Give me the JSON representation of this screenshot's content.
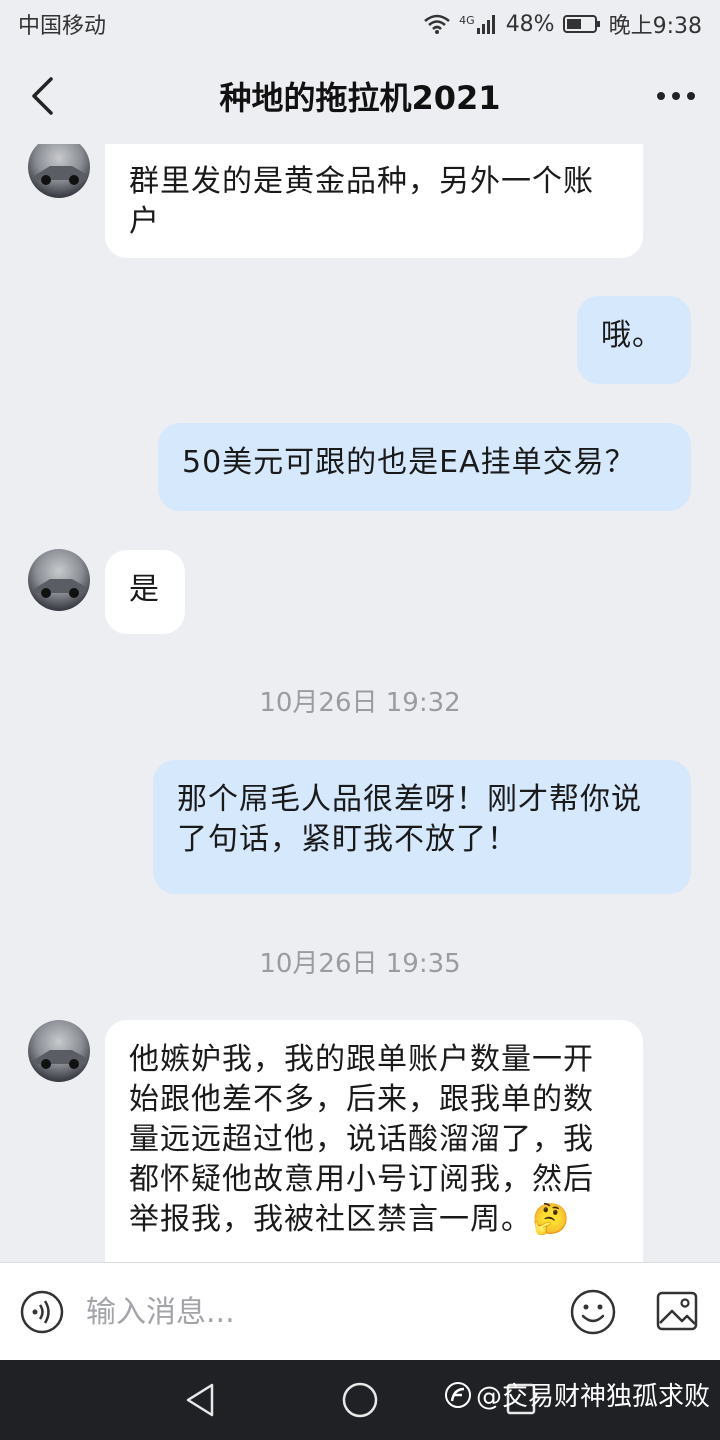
{
  "status_bar": {
    "carrier": "中国移动",
    "network": "4G",
    "battery": "48%",
    "time": "晚上9:38"
  },
  "header": {
    "title": "种地的拖拉机2021"
  },
  "messages": {
    "m1": "群里发的是黄金品种，另外一个账户",
    "m2": "哦。",
    "m3": "50美元可跟的也是EA挂单交易？",
    "m4": "是",
    "t1": "10月26日 19:32",
    "m5": "那个屌毛人品很差呀！刚才帮你说了句话，紧盯我不放了！",
    "t2": "10月26日 19:35",
    "m6": "他嫉妒我，我的跟单账户数量一开始跟他差不多，后来，跟我单的数量远远超过他，说话酸溜溜了，我都怀疑他故意用小号订阅我，然后举报我，我被社区禁言一周。🤔"
  },
  "input": {
    "placeholder": "输入消息..."
  },
  "watermark": {
    "text": "@交易财神独孤求败"
  },
  "colors": {
    "background": "#EDEEF2",
    "incoming_bubble": "#FFFFFF",
    "outgoing_bubble": "#D5E8FC",
    "nav_bar": "#202124"
  }
}
